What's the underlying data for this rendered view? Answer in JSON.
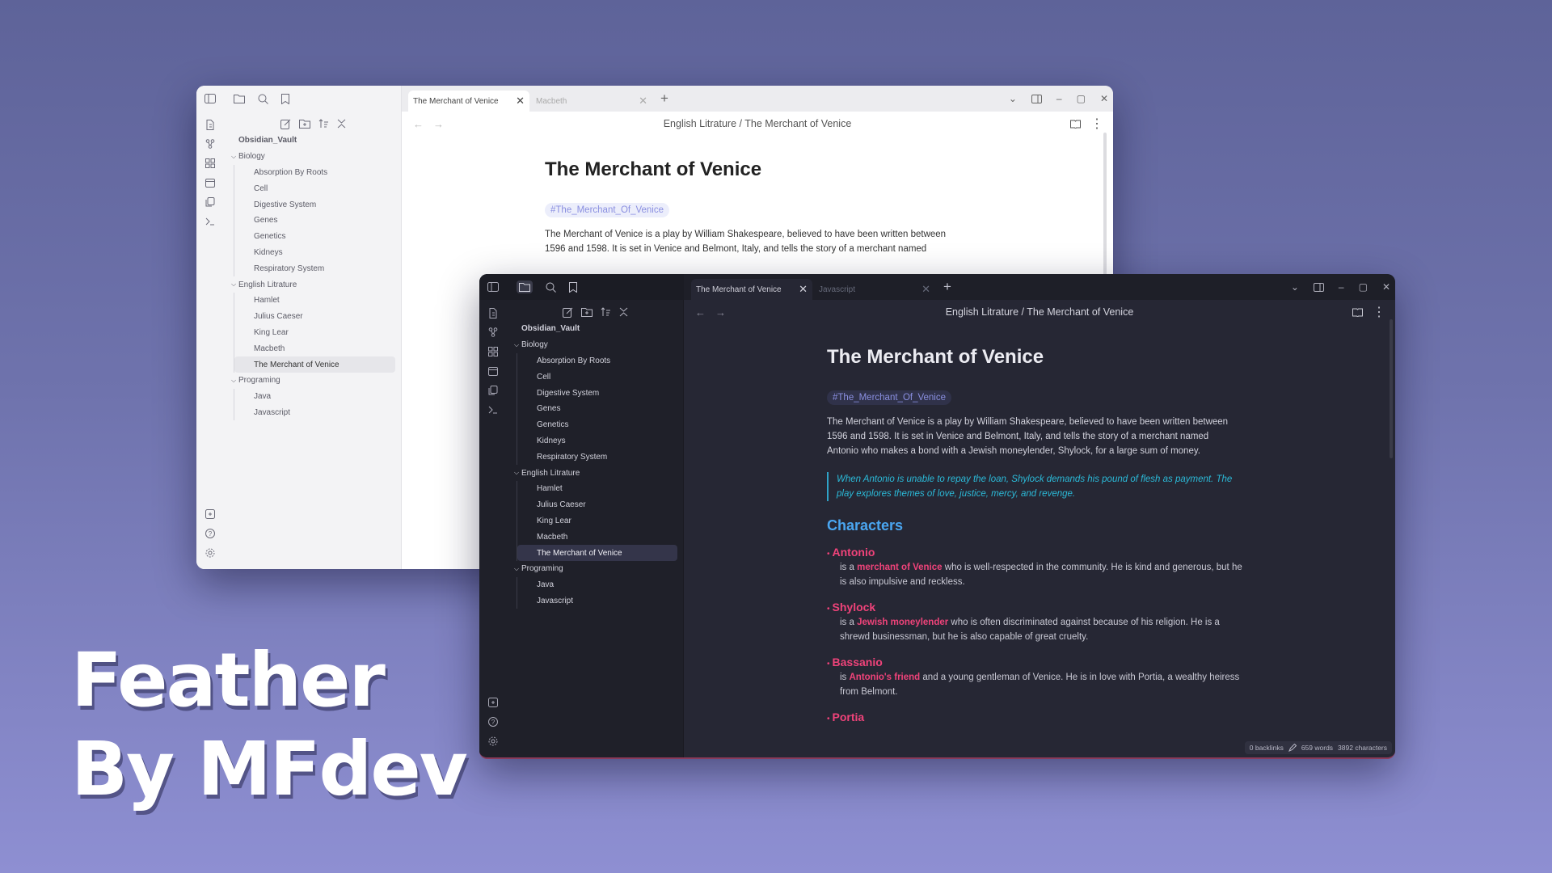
{
  "brand": {
    "line1": "Feather",
    "line2": "By MFdev"
  },
  "colors": {
    "accent": "#4aa6f1",
    "character_name": "#f0437a",
    "quote": "#2bbad8",
    "tag": "#8a8fe0"
  },
  "sidebar": {
    "vault": "Obsidian_Vault",
    "folders": [
      {
        "name": "Biology",
        "files": [
          "Absorption By Roots",
          "Cell",
          "Digestive System",
          "Genes",
          "Genetics",
          "Kidneys",
          "Respiratory System"
        ]
      },
      {
        "name": "English Litrature",
        "files": [
          "Hamlet",
          "Julius Caeser",
          "King Lear",
          "Macbeth",
          "The Merchant of Venice"
        ]
      },
      {
        "name": "Programing",
        "files": [
          "Java",
          "Javascript"
        ]
      }
    ],
    "selected": "The Merchant of Venice"
  },
  "light": {
    "tabs": [
      {
        "label": "The Merchant of Venice"
      },
      {
        "label": "Macbeth"
      }
    ],
    "breadcrumb": {
      "folder": "English Litrature",
      "sep": "/",
      "note": "The Merchant of Venice"
    },
    "title": "The Merchant of Venice",
    "tag": "#The_Merchant_Of_Venice",
    "para": "The Merchant of Venice is a play by William Shakespeare, believed to have been written between 1596 and 1598. It is set in Venice and Belmont, Italy, and tells the story of a merchant named"
  },
  "dark": {
    "tabs": [
      {
        "label": "The Merchant of Venice"
      },
      {
        "label": "Javascript"
      }
    ],
    "breadcrumb": {
      "folder": "English Litrature",
      "sep": "/",
      "note": "The Merchant of Venice"
    },
    "title": "The Merchant of Venice",
    "tag": "#The_Merchant_Of_Venice",
    "para": "The Merchant of Venice is a play by William Shakespeare, believed to have been written between 1596 and 1598. It is set in Venice and Belmont, Italy, and tells the story of a merchant named Antonio who makes a bond with a Jewish moneylender, Shylock, for a large sum of money.",
    "quote": "When Antonio is unable to repay the loan, Shylock demands his pound of flesh as payment. The play explores themes of love, justice, mercy, and revenge.",
    "characters_heading": "Characters",
    "characters": [
      {
        "name": "Antonio",
        "pre": "is a ",
        "hl": "merchant of Venice",
        "post": " who is well-respected in the community. He is kind and generous, but he is also impulsive and reckless."
      },
      {
        "name": "Shylock",
        "pre": "is a ",
        "hl": "Jewish moneylender",
        "post": " who is often discriminated against because of his religion. He is a shrewd businessman, but he is also capable of great cruelty."
      },
      {
        "name": "Bassanio",
        "pre": "is ",
        "hl": "Antonio's friend",
        "post": " and a young gentleman of Venice. He is in love with Portia, a wealthy heiress from Belmont."
      },
      {
        "name": "Portia",
        "pre": "",
        "hl": "",
        "post": ""
      }
    ],
    "status": {
      "backlinks": "0 backlinks",
      "words": "659 words",
      "chars": "3892 characters"
    }
  },
  "icons": {
    "ribbon": [
      "files-icon",
      "graph-icon",
      "canvas-icon",
      "calendar-icon",
      "copy-icon",
      "terminal-icon"
    ],
    "ribbon_bottom": [
      "vault-icon",
      "help-icon",
      "settings-icon"
    ]
  }
}
